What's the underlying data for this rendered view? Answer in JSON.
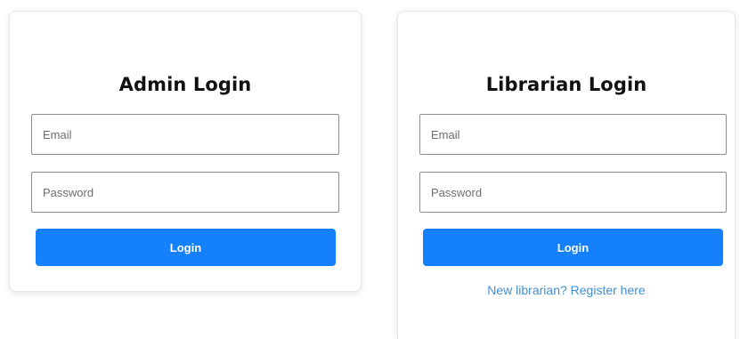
{
  "admin_login": {
    "title": "Admin Login",
    "email_placeholder": "Email",
    "password_placeholder": "Password",
    "login_button": "Login"
  },
  "librarian_login": {
    "title": "Librarian Login",
    "email_placeholder": "Email",
    "password_placeholder": "Password",
    "login_button": "Login",
    "register_link": "New librarian? Register here"
  },
  "colors": {
    "button_bg": "#1580fb",
    "link": "#3f8fd0",
    "field_border": "#8e8e8e"
  }
}
